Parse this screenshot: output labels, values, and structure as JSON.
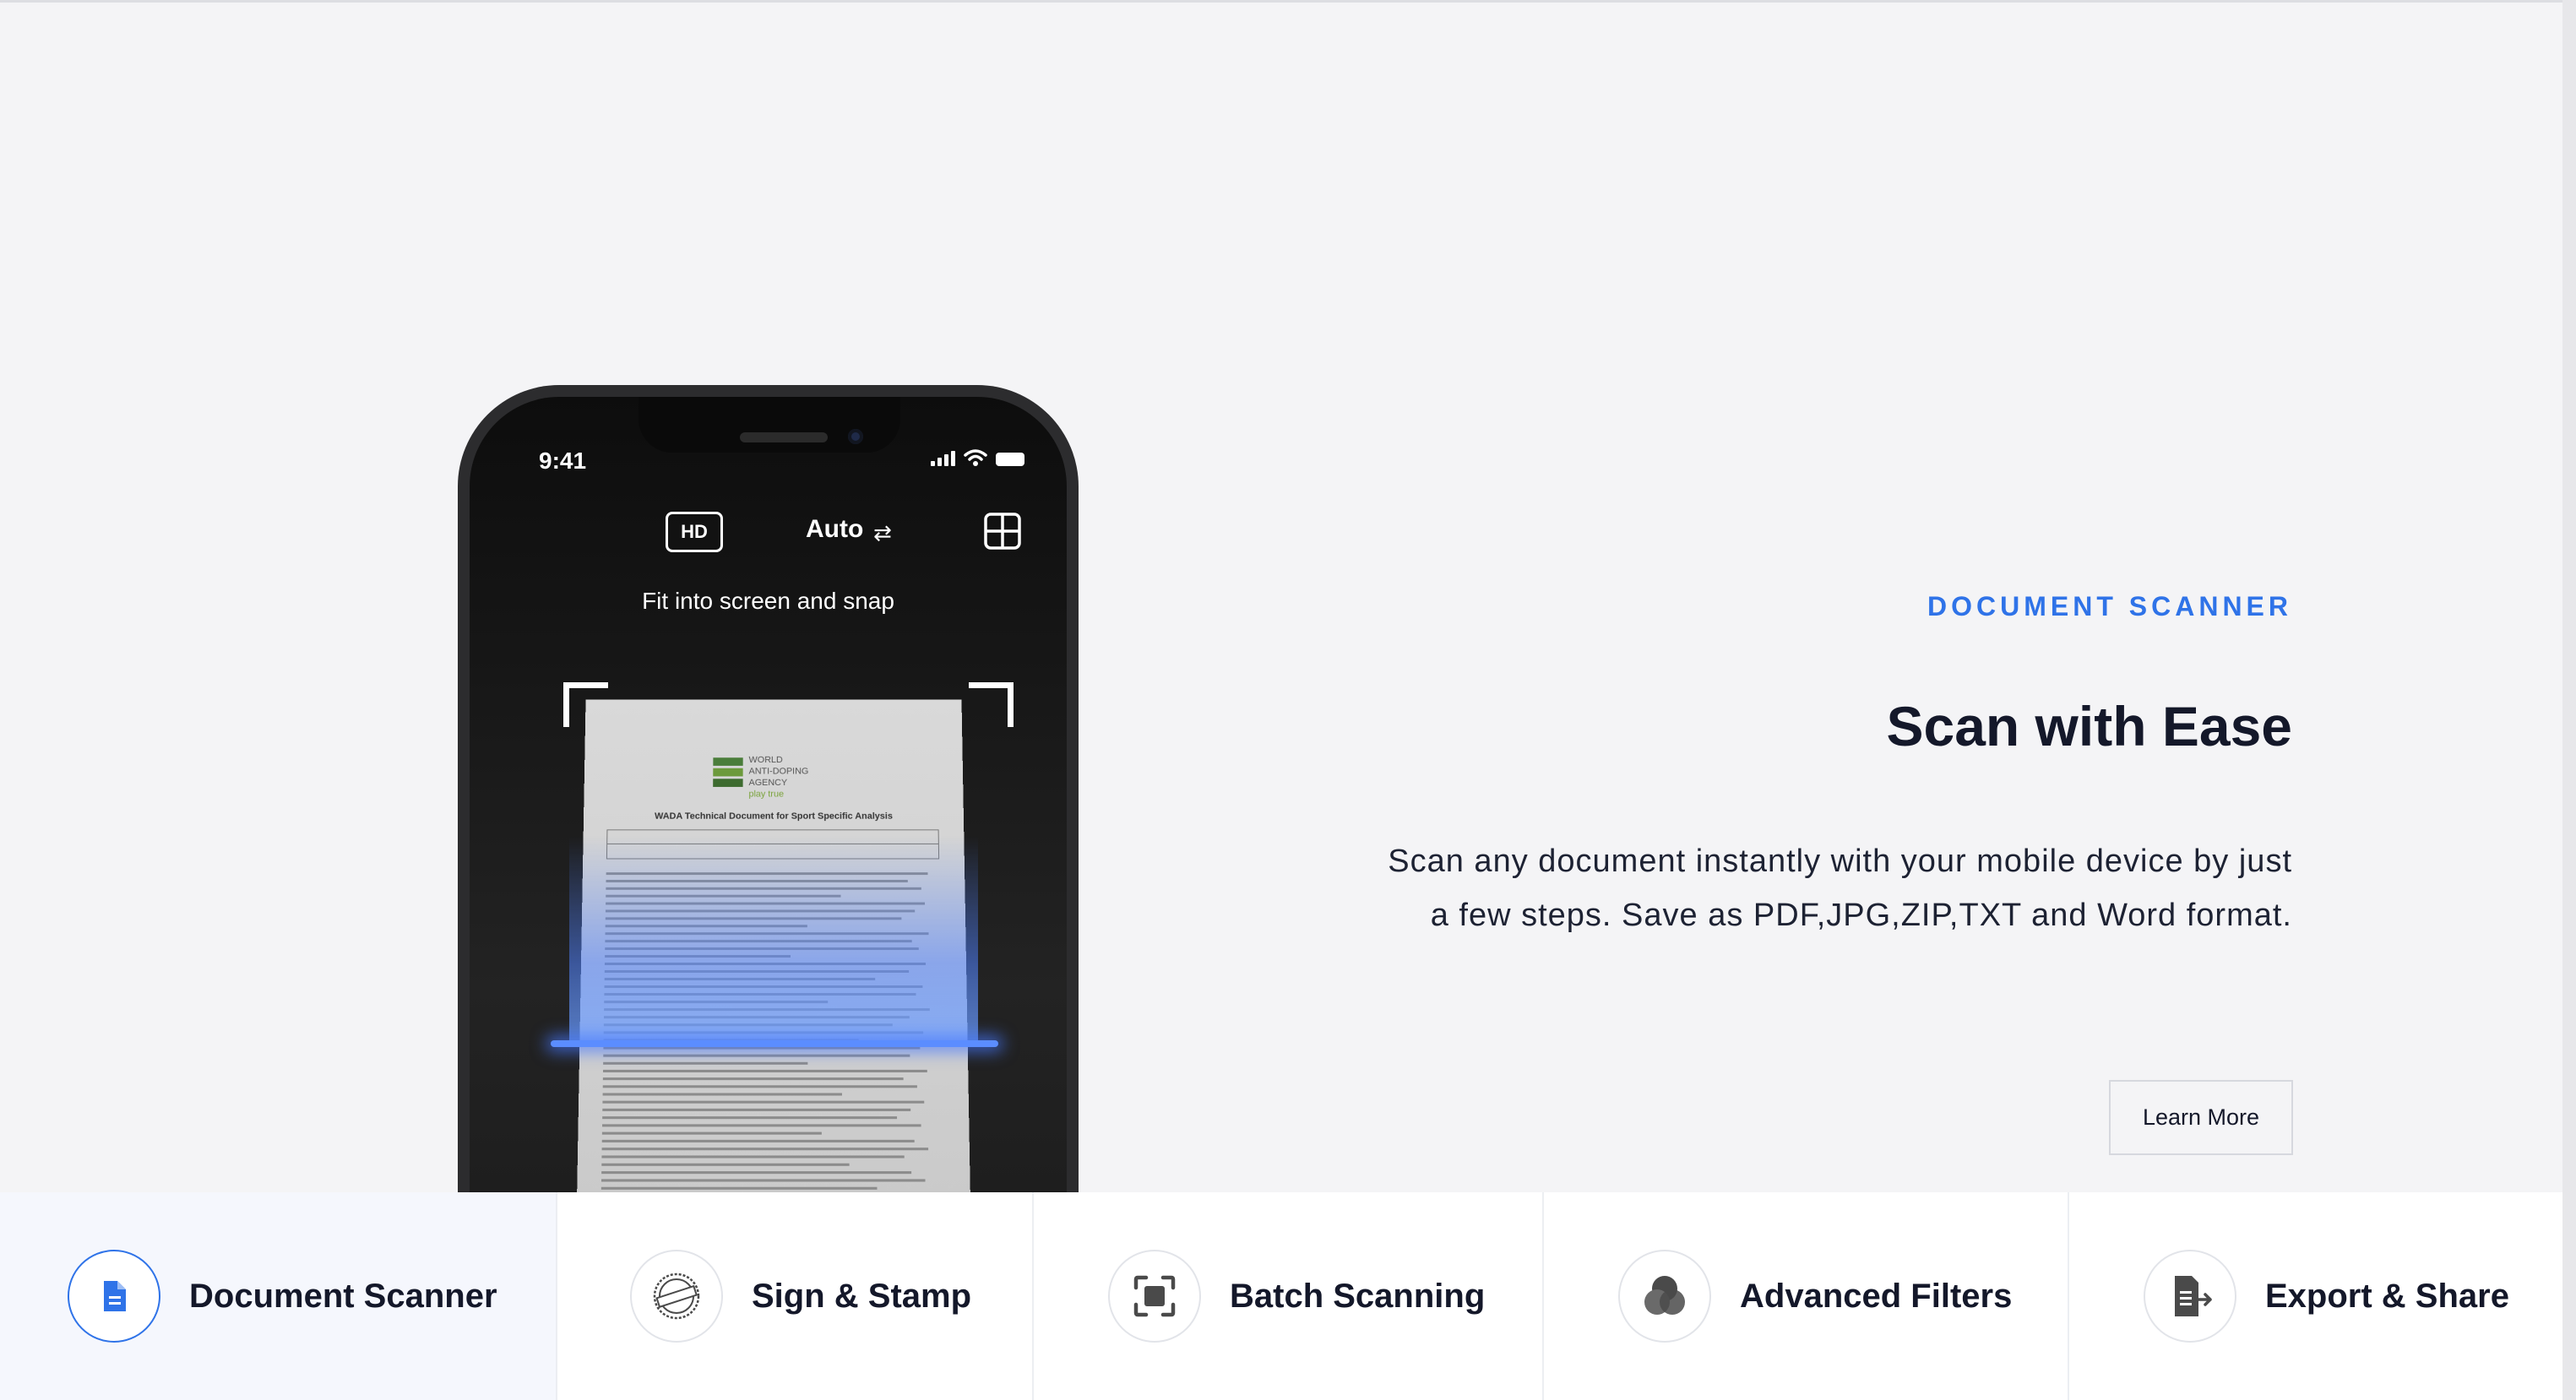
{
  "phone": {
    "time": "9:41",
    "hd_label": "HD",
    "mode_label": "Auto",
    "hint": "Fit into screen and snap",
    "document": {
      "org_lines": [
        "WORLD",
        "ANTI-DOPING",
        "AGENCY"
      ],
      "org_tagline": "play true",
      "title": "WADA Technical Document for Sport Specific Analysis"
    }
  },
  "hero": {
    "eyebrow": "DOCUMENT SCANNER",
    "title": "Scan with Ease",
    "description": "Scan any document instantly with your mobile device by just a few steps. Save as PDF,JPG,ZIP,TXT and Word format.",
    "cta_label": "Learn More"
  },
  "features": {
    "tabs": [
      {
        "label": "Document Scanner",
        "icon": "document-icon",
        "active": true
      },
      {
        "label": "Sign & Stamp",
        "icon": "certified-stamp-icon",
        "active": false
      },
      {
        "label": "Batch Scanning",
        "icon": "batch-scan-icon",
        "active": false
      },
      {
        "label": "Advanced Filters",
        "icon": "filters-icon",
        "active": false
      },
      {
        "label": "Export & Share",
        "icon": "export-icon",
        "active": false
      }
    ]
  },
  "colors": {
    "accent": "#2f73e8",
    "background": "#f4f4f6",
    "heading": "#14182a"
  }
}
